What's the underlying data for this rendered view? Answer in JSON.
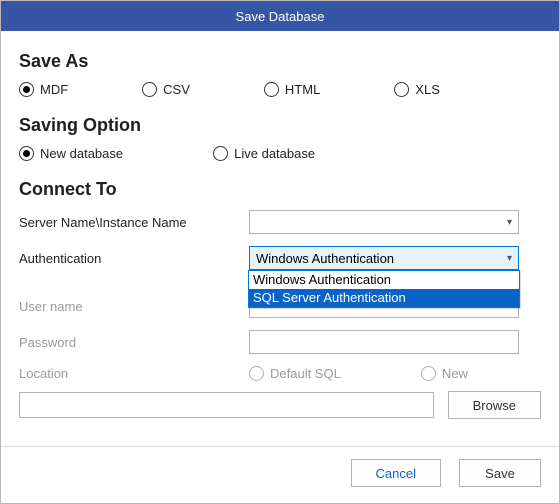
{
  "title": "Save Database",
  "sections": {
    "save_as": {
      "heading": "Save As"
    },
    "saving_option": {
      "heading": "Saving Option"
    },
    "connect_to": {
      "heading": "Connect To"
    }
  },
  "save_as_options": {
    "mdf": "MDF",
    "csv": "CSV",
    "html": "HTML",
    "xls": "XLS",
    "selected": "mdf"
  },
  "saving_options": {
    "new_db": "New database",
    "live_db": "Live database",
    "selected": "new_db"
  },
  "connect": {
    "server_label": "Server Name\\Instance Name",
    "server_value": "",
    "auth_label": "Authentication",
    "auth_selected": "Windows Authentication",
    "auth_options": {
      "windows": "Windows Authentication",
      "sql": "SQL Server Authentication"
    },
    "auth_highlighted": "sql",
    "user_label": "User name",
    "user_value": "",
    "pass_label": "Password",
    "pass_value": "",
    "location_label": "Location",
    "location_options": {
      "default": "Default SQL",
      "new": "New"
    },
    "path_value": "",
    "browse_label": "Browse"
  },
  "footer": {
    "cancel": "Cancel",
    "save": "Save"
  }
}
